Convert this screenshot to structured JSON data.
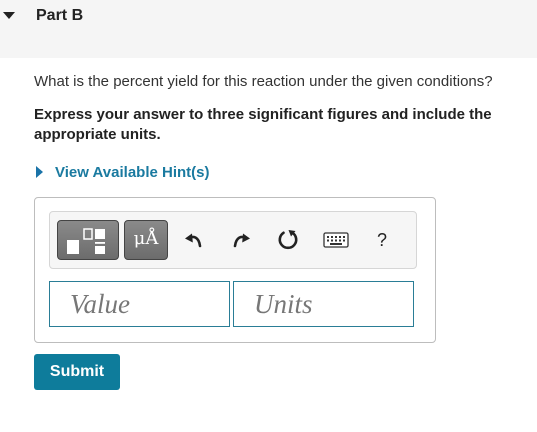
{
  "part": {
    "title": "Part B"
  },
  "question": {
    "text": "What is the percent yield for this reaction under the given conditions?",
    "instruction": "Express your answer to three significant figures and include the appropriate units."
  },
  "hint": {
    "label": "View Available Hint(s)"
  },
  "toolbar": {
    "units_button_label": "μÅ",
    "help_label": "?",
    "icons": [
      "templates-icon",
      "units-icon",
      "undo-icon",
      "redo-icon",
      "reset-icon",
      "keyboard-icon",
      "help-icon"
    ]
  },
  "answer": {
    "value_placeholder": "Value",
    "units_placeholder": "Units"
  },
  "submit": {
    "label": "Submit"
  },
  "colors": {
    "accent": "#0e7c9b",
    "link": "#1a7aa0",
    "input_border": "#2a7d96"
  }
}
